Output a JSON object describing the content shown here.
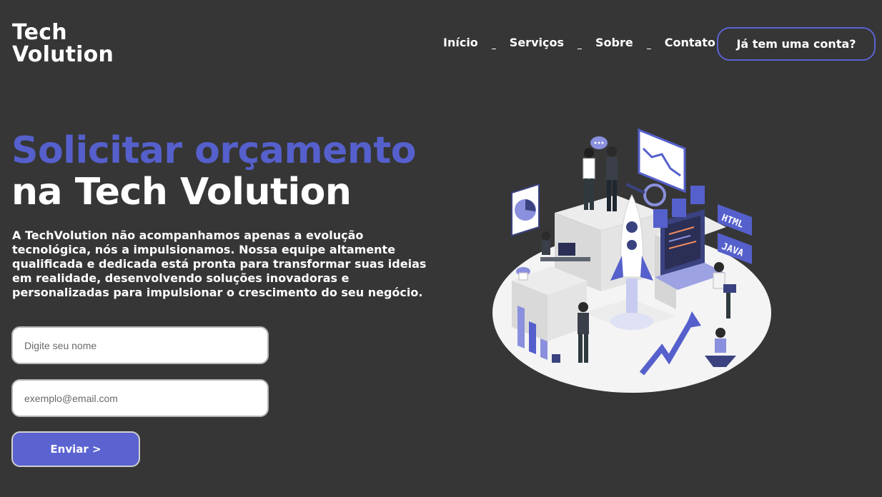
{
  "brand": {
    "line1": "Tech",
    "line2": "Volution"
  },
  "nav": {
    "items": [
      {
        "label": "Início"
      },
      {
        "label": "Serviços"
      },
      {
        "label": "Sobre"
      },
      {
        "label": "Contato"
      }
    ],
    "account_button": "Já tem uma conta?"
  },
  "hero": {
    "title_accent": "Solicitar orçamento",
    "title_rest": "na Tech Volution",
    "description": "A TechVolution não acompanhamos apenas a evolução tecnológica, nós a impulsionamos. Nossa equipe altamente qualificada e dedicada está pronta para transformar suas ideias em realidade, desenvolvendo soluções inovadoras e personalizadas para impulsionar o crescimento do seu negócio."
  },
  "form": {
    "name_placeholder": "Digite seu nome",
    "name_value": "",
    "email_placeholder": "exemplo@email.com",
    "email_value": "",
    "submit_label": "Enviar >"
  },
  "illustration": {
    "labels": {
      "html": "HTML",
      "java": "JAVA"
    }
  },
  "colors": {
    "background": "#363636",
    "accent": "#5560cc",
    "button": "#5b63d1"
  }
}
